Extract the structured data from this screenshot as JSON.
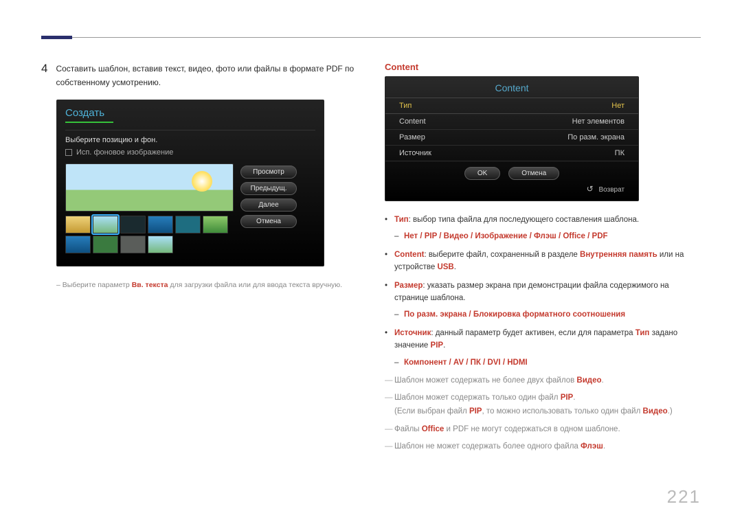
{
  "page_number": "221",
  "left": {
    "step_number": "4",
    "step_text": "Составить шаблон, вставив текст, видео, фото или файлы в формате PDF по собственному усмотрению.",
    "create_dialog": {
      "title": "Создать",
      "subtitle": "Выберите позицию и фон.",
      "checkbox_label": "Исп. фоновое изображение",
      "buttons": {
        "preview": "Просмотр",
        "previous": "Предыдущ.",
        "next": "Далее",
        "cancel": "Отмена"
      }
    },
    "footnote_prefix": "– Выберите параметр ",
    "footnote_bold": "Вв. текста",
    "footnote_suffix": " для загрузки файла или для ввода текста вручную."
  },
  "right": {
    "section_title": "Content",
    "content_dialog": {
      "title": "Content",
      "rows": [
        {
          "label": "Тип",
          "value": "Нет",
          "highlight": true
        },
        {
          "label": "Content",
          "value": "Нет элементов"
        },
        {
          "label": "Размер",
          "value": "По разм. экрана"
        },
        {
          "label": "Источник",
          "value": "ПК"
        }
      ],
      "ok": "OK",
      "cancel": "Отмена",
      "return": "Возврат"
    },
    "bullet_tip_label": "Тип",
    "bullet_tip_text": ": выбор типа файла для последующего составления шаблона.",
    "tip_options": "Нет / PIP / Видео / Изображение / Флэш / Office / PDF",
    "bullet_content_label": "Content",
    "bullet_content_text1": ": выберите файл, сохраненный в разделе ",
    "bullet_content_mem": "Внутренняя память",
    "bullet_content_text2": " или на устройстве ",
    "bullet_content_usb": "USB",
    "bullet_size_label": "Размер",
    "bullet_size_text": ": указать размер экрана при демонстрации файла содержимого на странице шаблона.",
    "size_options": "По разм. экрана / Блокировка форматного соотношения",
    "bullet_source_label": "Источник",
    "bullet_source_text1": ": данный параметр будет активен, если для параметра ",
    "bullet_source_tip": "Тип",
    "bullet_source_text2": " задано значение ",
    "bullet_source_pip": "PIP",
    "source_options": "Компонент / AV / ПК / DVI / HDMI",
    "note1a": "Шаблон может содержать не более двух файлов ",
    "note1b": "Видео",
    "note2a": "Шаблон может содержать только один файл ",
    "note2b": "PIP",
    "note2c": "(Если выбран файл ",
    "note2d": "PIP",
    "note2e": ", то можно использовать только один файл ",
    "note2f": "Видео",
    "note2g": ".)",
    "note3a": "Файлы ",
    "note3b": "Office",
    "note3c": " и PDF не могут содержаться в одном шаблоне.",
    "note4a": "Шаблон не может содержать более одного файла ",
    "note4b": "Флэш"
  }
}
